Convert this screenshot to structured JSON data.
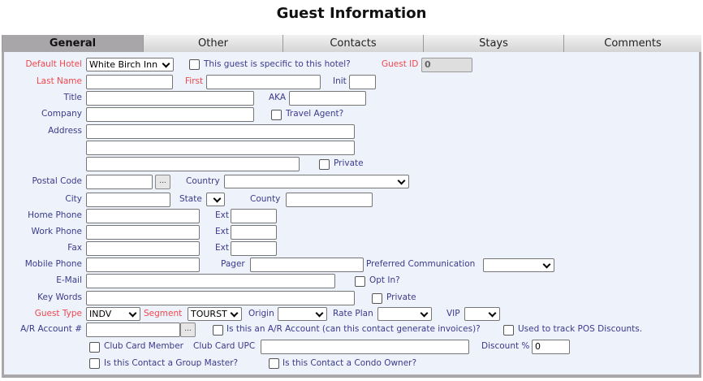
{
  "title": "Guest Information",
  "tabs": [
    "General",
    "Other",
    "Contacts",
    "Stays",
    "Comments"
  ],
  "active_tab": "General",
  "f": {
    "default_hotel": "Default Hotel",
    "default_hotel_value": "White Birch Inn",
    "hotel_specific": "This guest is specific to this hotel?",
    "guest_id": "Guest ID",
    "guest_id_value": "0",
    "last_name": "Last Name",
    "first": "First",
    "init": "Init",
    "title": "Title",
    "aka": "AKA",
    "company": "Company",
    "travel_agent": "Travel Agent?",
    "address": "Address",
    "private": "Private",
    "postal_code": "Postal Code",
    "lookup": "...",
    "country": "Country",
    "city": "City",
    "state": "State",
    "county": "County",
    "home_phone": "Home Phone",
    "work_phone": "Work Phone",
    "fax": "Fax",
    "ext": "Ext",
    "mobile_phone": "Mobile Phone",
    "pager": "Pager",
    "preferred_communication": "Preferred Communication",
    "email": "E-Mail",
    "opt_in": "Opt In?",
    "key_words": "Key Words",
    "guest_type": "Guest Type",
    "guest_type_value": "INDV",
    "segment": "Segment",
    "segment_value": "TOURST",
    "origin": "Origin",
    "rate_plan": "Rate Plan",
    "vip": "VIP",
    "ar_account": "A/R Account #",
    "is_ar_account": "Is this an A/R Account (can this contact generate invoices)?",
    "pos_discounts": "Used to track POS Discounts.",
    "club_card_member": "Club Card Member",
    "club_card_upc": "Club Card UPC",
    "discount": "Discount %",
    "discount_value": "0",
    "group_master": "Is this Contact a Group Master?",
    "condo_owner": "Is this Contact a Condo Owner?"
  }
}
